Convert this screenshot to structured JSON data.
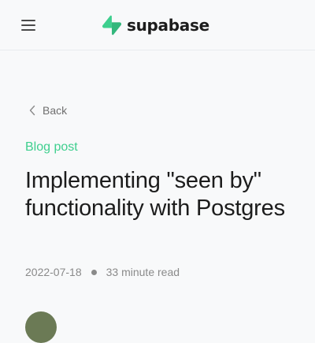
{
  "header": {
    "brand": "supabase",
    "brand_color": "#3ecf8e",
    "menu_icon": "hamburger-menu-icon",
    "logo_icon": "supabase-bolt-icon"
  },
  "nav": {
    "back_label": "Back",
    "back_icon": "chevron-left-icon"
  },
  "article": {
    "category": "Blog post",
    "title": "Implementing \"seen by\" functionality with Postgres",
    "date": "2022-07-18",
    "read_time": "33 minute read",
    "separator_icon": "dot-icon"
  },
  "author": {
    "avatar_color": "#6b7a55"
  }
}
